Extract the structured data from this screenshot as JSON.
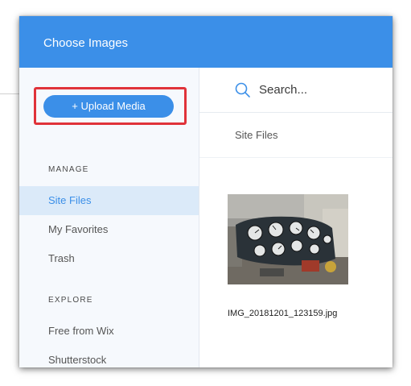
{
  "dialog": {
    "title": "Choose Images",
    "accent_color": "#3b8fe8",
    "highlight_color": "#e0333a"
  },
  "sidebar": {
    "upload_label": "+ Upload Media",
    "sections": [
      {
        "label": "MANAGE",
        "items": [
          {
            "label": "Site Files",
            "active": true
          },
          {
            "label": "My Favorites",
            "active": false
          },
          {
            "label": "Trash",
            "active": false
          }
        ]
      },
      {
        "label": "EXPLORE",
        "items": [
          {
            "label": "Free from Wix",
            "active": false
          },
          {
            "label": "Shutterstock",
            "active": false
          }
        ]
      }
    ]
  },
  "main": {
    "search": {
      "placeholder": "Search...",
      "value": "",
      "icon": "search-icon"
    },
    "breadcrumb": "Site Files",
    "files": [
      {
        "name": "IMG_20181201_123159.jpg",
        "thumbnail": "aircraft-instrument-panel-photo"
      }
    ]
  }
}
